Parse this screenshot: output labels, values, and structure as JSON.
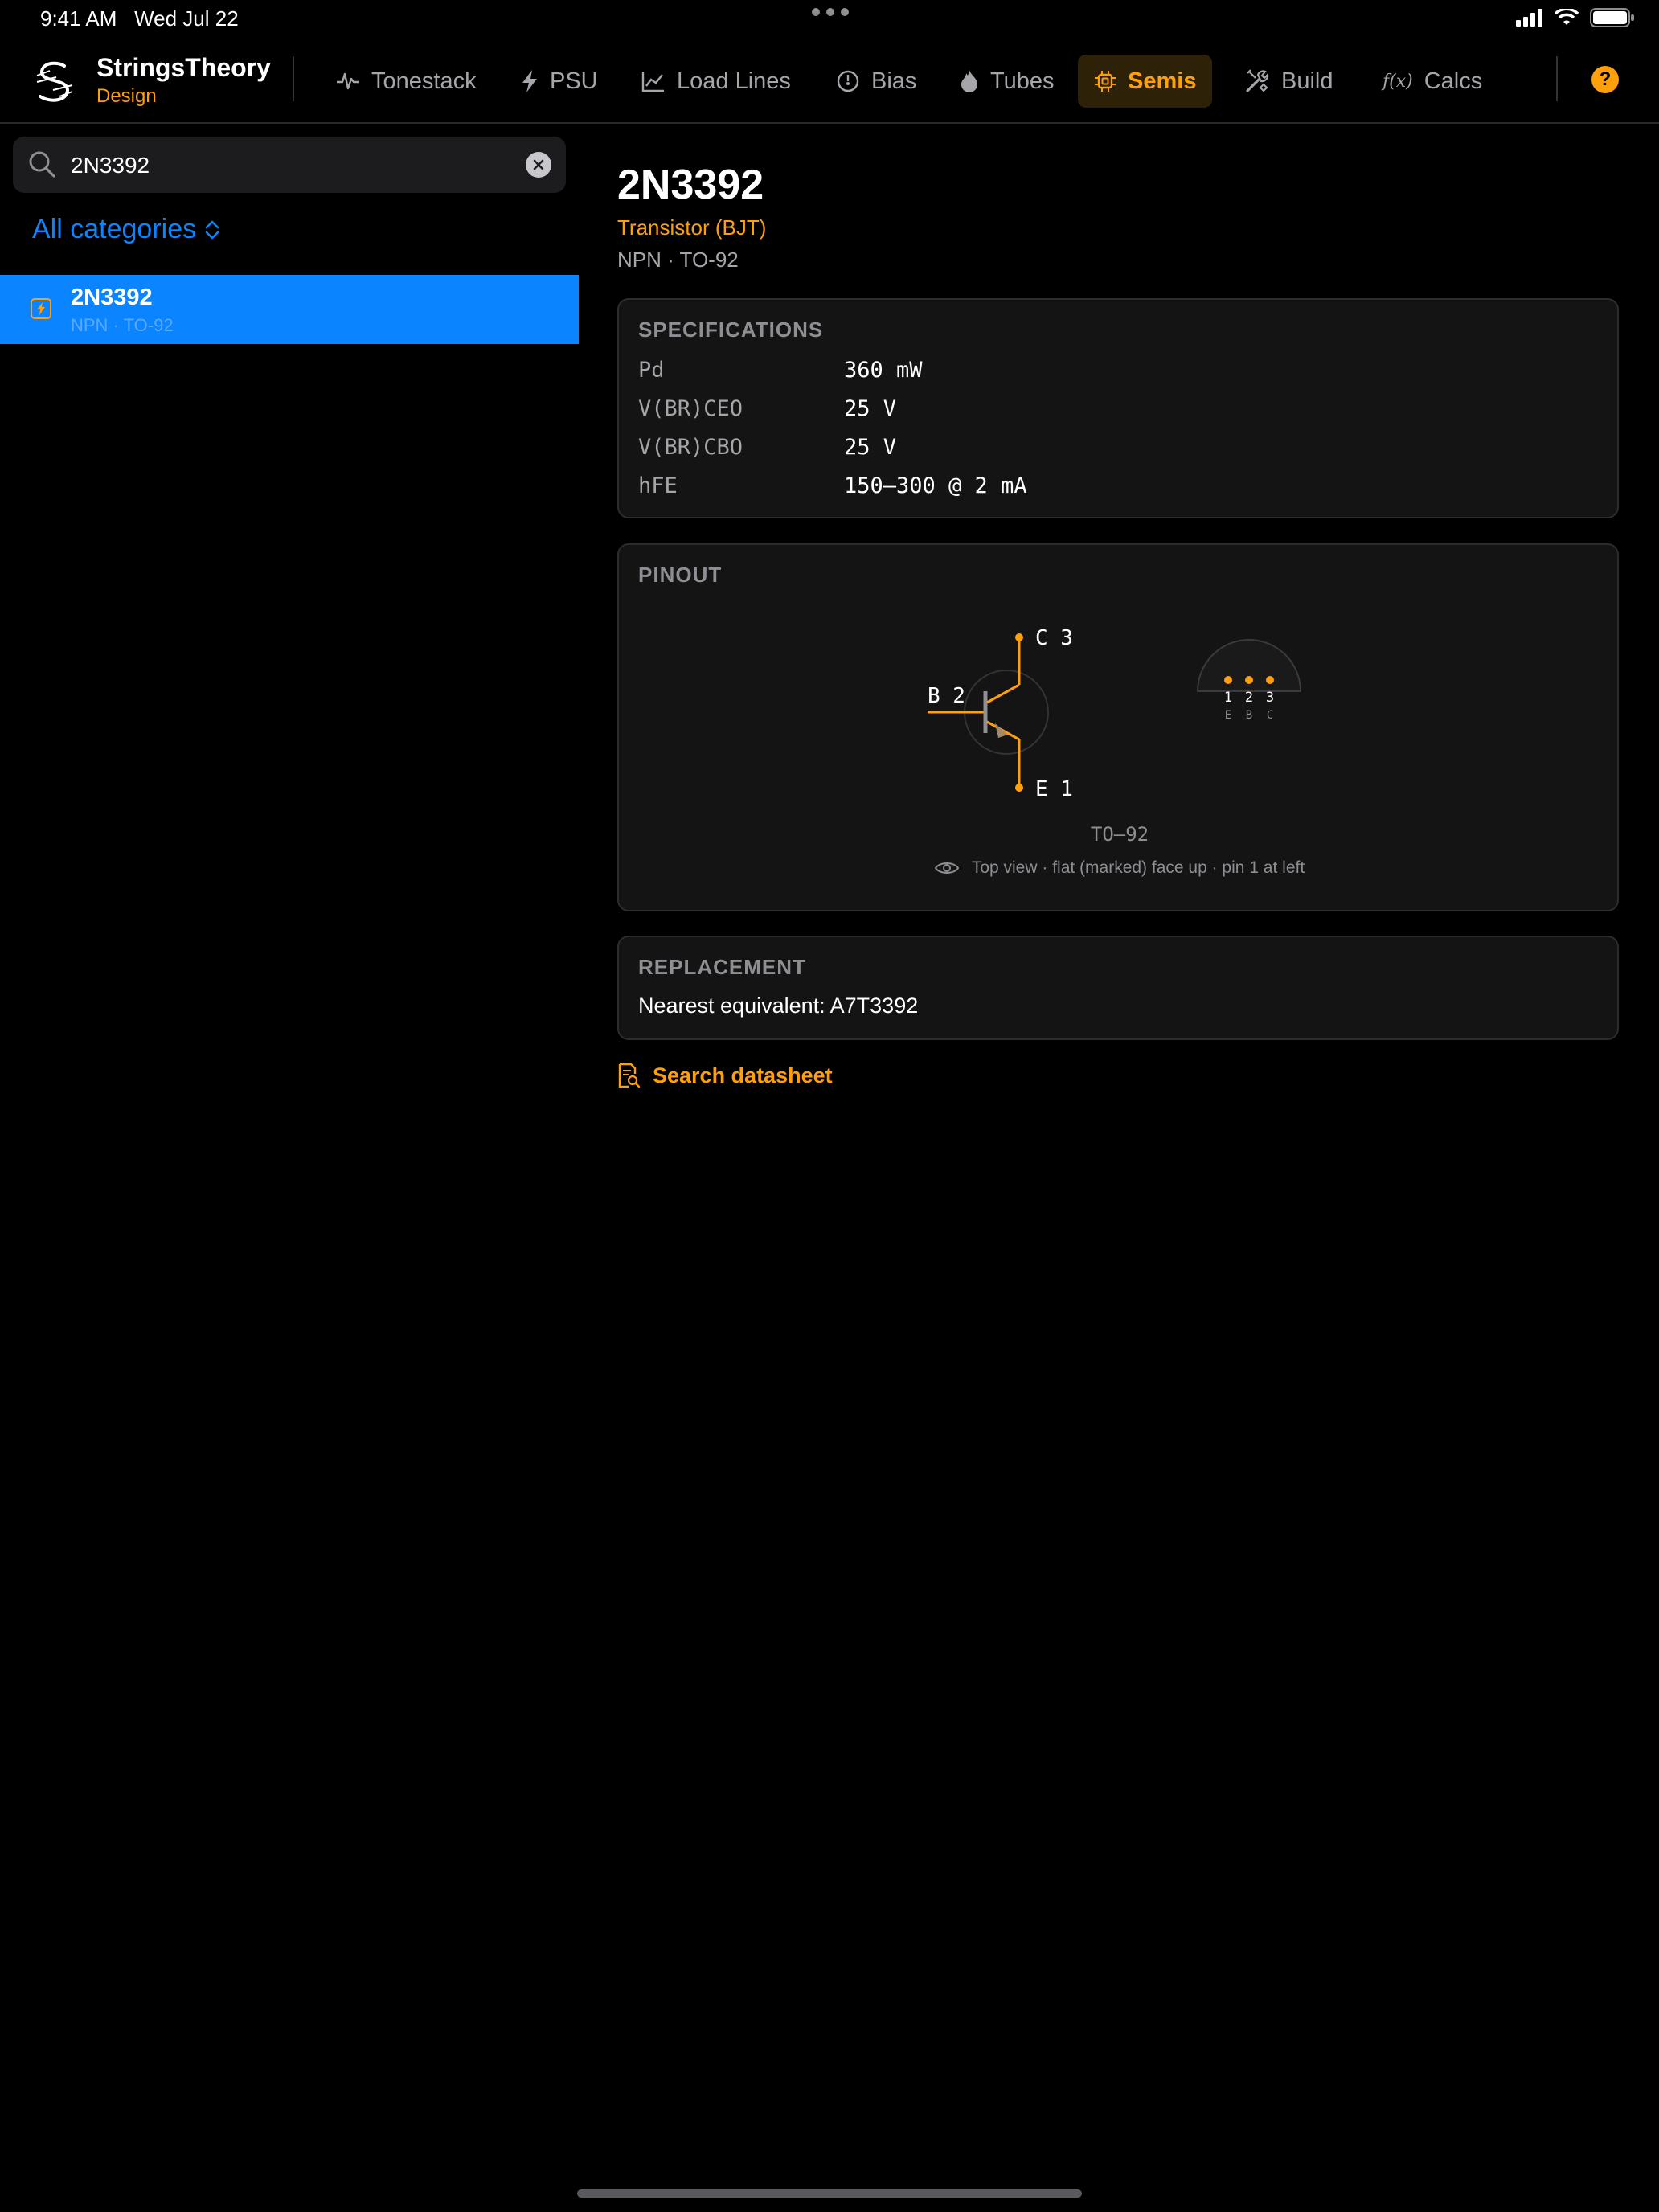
{
  "status_bar": {
    "time": "9:41 AM",
    "date": "Wed Jul 22"
  },
  "brand": {
    "title": "StringsTheory",
    "subtitle": "Design"
  },
  "tabs": [
    {
      "label": "Tonestack",
      "icon": "waveform-icon"
    },
    {
      "label": "PSU",
      "icon": "bolt-icon"
    },
    {
      "label": "Load Lines",
      "icon": "chart-line-icon"
    },
    {
      "label": "Bias",
      "icon": "gauge-icon"
    },
    {
      "label": "Tubes",
      "icon": "flame-icon"
    },
    {
      "label": "Semis",
      "icon": "cpu-icon",
      "active": true
    },
    {
      "label": "Build",
      "icon": "tools-icon"
    },
    {
      "label": "Calcs",
      "icon": "function-icon",
      "icon_text": "f(x)"
    }
  ],
  "help_label": "?",
  "sidebar": {
    "search_value": "2N3392",
    "categories_label": "All categories",
    "items": [
      {
        "title": "2N3392",
        "subtitle": "NPN · TO-92",
        "selected": true
      }
    ]
  },
  "detail": {
    "title": "2N3392",
    "type": "Transistor (BJT)",
    "package_line": "NPN · TO-92",
    "specs_header": "SPECIFICATIONS",
    "specs": [
      {
        "label": "Pd",
        "value": "360 mW"
      },
      {
        "label": "V(BR)CEO",
        "value": "25 V"
      },
      {
        "label": "V(BR)CBO",
        "value": "25 V"
      },
      {
        "label": "hFE",
        "value": "150–300 @ 2 mA"
      }
    ],
    "pinout_header": "PINOUT",
    "pinout": {
      "collector_label": "C 3",
      "base_label": "B 2",
      "emitter_label": "E 1",
      "pin_numbers": [
        "1",
        "2",
        "3"
      ],
      "pin_letters": [
        "E",
        "B",
        "C"
      ],
      "package_label": "TO–92",
      "view_note": "Top view · flat (marked) face up · pin 1 at left"
    },
    "replacement_header": "REPLACEMENT",
    "replacement_text": "Nearest equivalent: A7T3392",
    "datasheet_label": "Search datasheet"
  },
  "colors": {
    "accent": "#ff9f0a",
    "selection": "#0a84ff",
    "background": "#000000",
    "card": "#141414"
  }
}
